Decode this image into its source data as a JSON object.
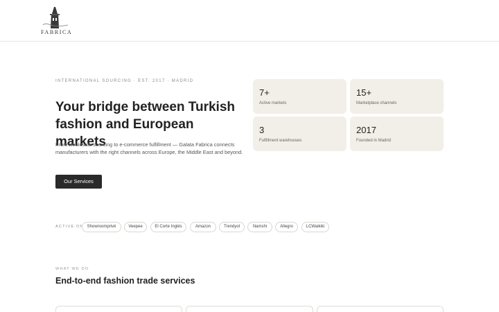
{
  "brand": {
    "logo_text": "FABRICA"
  },
  "hero": {
    "eyebrow": "INTERNATIONAL SOURCING · EST. 2017 · MADRID",
    "headline": "Your bridge between Turkish fashion and European markets",
    "lead": "From wholesale sourcing to e-commerce fulfillment — Galata Fabrica connects manufacturers with the right channels across Europe, the Middle East and beyond.",
    "cta_label": "Our Services"
  },
  "stats": [
    {
      "value": "7+",
      "label": "Active markets"
    },
    {
      "value": "15+",
      "label": "Marketplace channels"
    },
    {
      "value": "3",
      "label": "Fulfillment warehouses"
    },
    {
      "value": "2017",
      "label": "Founded in Madrid"
    }
  ],
  "channels": {
    "label": "ACTIVE ON",
    "items": [
      "Showroomprivé",
      "Veepee",
      "El Corte Inglés",
      "Amazon",
      "Trendyol",
      "Namshi",
      "Allegro",
      "LCWaikiki"
    ]
  },
  "services": {
    "eyebrow": "WHAT WE DO",
    "title": "End-to-end fashion trade services"
  },
  "colors": {
    "accent_dark": "#2a2a2a",
    "stat_bg": "#f2efe8",
    "border": "#e6e4df"
  }
}
